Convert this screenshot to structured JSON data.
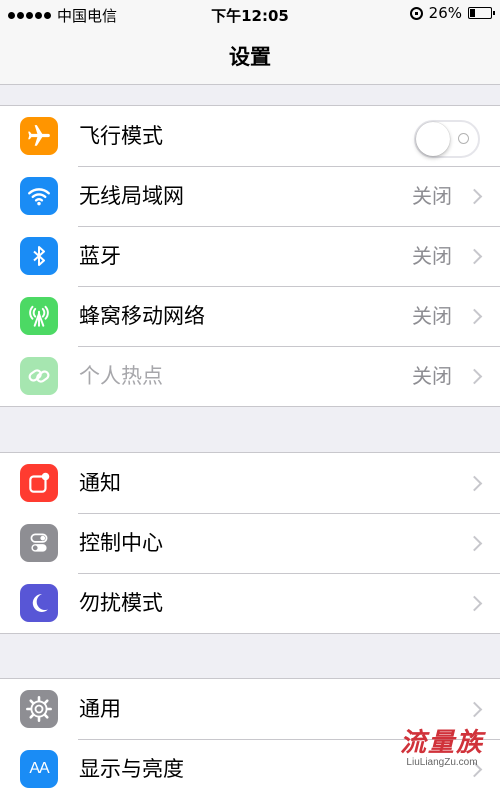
{
  "status_bar": {
    "carrier": "中国电信",
    "time": "下午12:05",
    "battery": "26%",
    "battery_level": 0.26
  },
  "nav": {
    "title": "设置"
  },
  "groups": [
    {
      "items": [
        {
          "label": "飞行模式",
          "icon": "airplane-icon",
          "color": "#ff9500",
          "toggle": false
        },
        {
          "label": "无线局域网",
          "icon": "wifi-icon",
          "color": "#1a8cf5",
          "value": "关闭"
        },
        {
          "label": "蓝牙",
          "icon": "bluetooth-icon",
          "color": "#1a8cf5",
          "value": "关闭"
        },
        {
          "label": "蜂窝移动网络",
          "icon": "cellular-antenna-icon",
          "color": "#4cd964",
          "value": "关闭"
        },
        {
          "label": "个人热点",
          "icon": "hotspot-link-icon",
          "color": "#a6e6b0",
          "value": "关闭",
          "disabled": true
        }
      ]
    },
    {
      "items": [
        {
          "label": "通知",
          "icon": "notification-icon",
          "color": "#ff3b30"
        },
        {
          "label": "控制中心",
          "icon": "control-center-icon",
          "color": "#8e8e93"
        },
        {
          "label": "勿扰模式",
          "icon": "moon-icon",
          "color": "#5856d6"
        }
      ]
    },
    {
      "items": [
        {
          "label": "通用",
          "icon": "gear-icon",
          "color": "#8e8e93"
        },
        {
          "label": "显示与亮度",
          "icon": "text-size-icon",
          "color": "#1a8cf5",
          "glyph": "AA"
        }
      ]
    }
  ],
  "watermark": {
    "main": "流量族",
    "sub": "LiuLiangZu.com"
  }
}
